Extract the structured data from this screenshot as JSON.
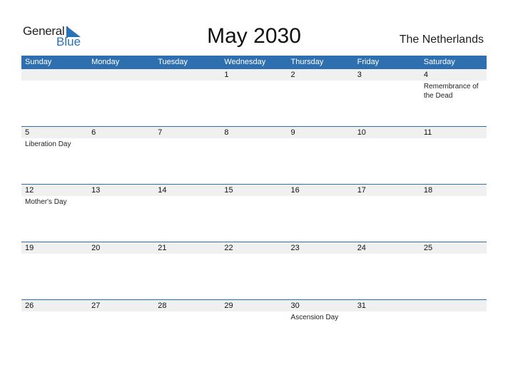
{
  "logo": {
    "general": "General",
    "blue": "Blue"
  },
  "title": "May 2030",
  "country": "The Netherlands",
  "colors": {
    "accent": "#2e6fb0",
    "strip": "#f0f0f0"
  },
  "weekdays": [
    "Sunday",
    "Monday",
    "Tuesday",
    "Wednesday",
    "Thursday",
    "Friday",
    "Saturday"
  ],
  "weeks": [
    [
      {
        "d": ""
      },
      {
        "d": ""
      },
      {
        "d": ""
      },
      {
        "d": "1"
      },
      {
        "d": "2"
      },
      {
        "d": "3"
      },
      {
        "d": "4",
        "ev": "Remembrance of the Dead"
      }
    ],
    [
      {
        "d": "5",
        "ev": "Liberation Day"
      },
      {
        "d": "6"
      },
      {
        "d": "7"
      },
      {
        "d": "8"
      },
      {
        "d": "9"
      },
      {
        "d": "10"
      },
      {
        "d": "11"
      }
    ],
    [
      {
        "d": "12",
        "ev": "Mother's Day"
      },
      {
        "d": "13"
      },
      {
        "d": "14"
      },
      {
        "d": "15"
      },
      {
        "d": "16"
      },
      {
        "d": "17"
      },
      {
        "d": "18"
      }
    ],
    [
      {
        "d": "19"
      },
      {
        "d": "20"
      },
      {
        "d": "21"
      },
      {
        "d": "22"
      },
      {
        "d": "23"
      },
      {
        "d": "24"
      },
      {
        "d": "25"
      }
    ],
    [
      {
        "d": "26"
      },
      {
        "d": "27"
      },
      {
        "d": "28"
      },
      {
        "d": "29"
      },
      {
        "d": "30",
        "ev": "Ascension Day"
      },
      {
        "d": "31"
      },
      {
        "d": ""
      }
    ]
  ]
}
